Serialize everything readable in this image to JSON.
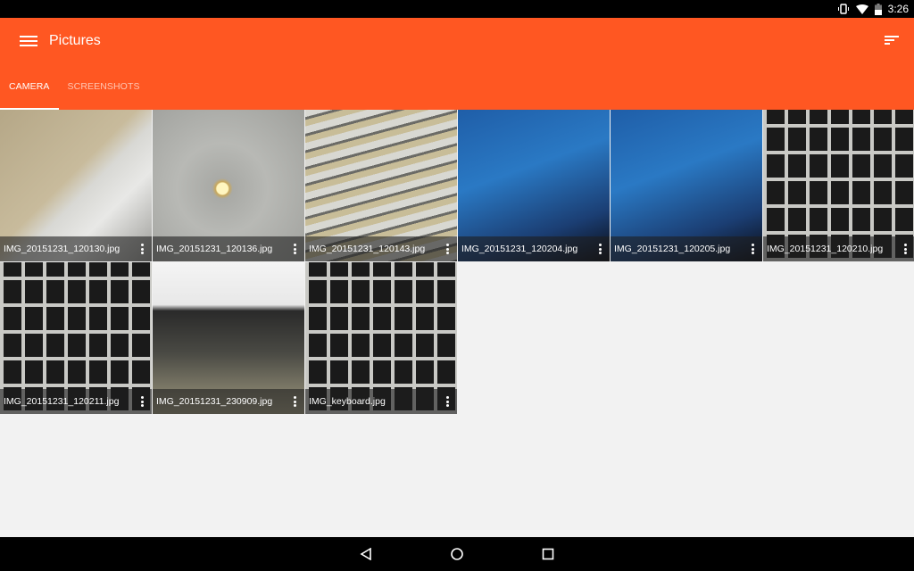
{
  "status_bar": {
    "time": "3:26",
    "icons": [
      "vibrate-icon",
      "wifi-icon",
      "battery-icon"
    ]
  },
  "app_bar": {
    "title": "Pictures",
    "menu_icon": "hamburger-menu-icon",
    "sort_icon": "sort-icon"
  },
  "tabs": [
    {
      "label": "CAMERA",
      "active": true
    },
    {
      "label": "SCREENSHOTS",
      "active": false
    }
  ],
  "photos": [
    {
      "name": "IMG_20151231_120130.jpg",
      "scene": "heater"
    },
    {
      "name": "IMG_20151231_120136.jpg",
      "scene": "ceiling"
    },
    {
      "name": "IMG_20151231_120143.jpg",
      "scene": "blinds"
    },
    {
      "name": "IMG_20151231_120204.jpg",
      "scene": "screen"
    },
    {
      "name": "IMG_20151231_120205.jpg",
      "scene": "screen"
    },
    {
      "name": "IMG_20151231_120210.jpg",
      "scene": "keyboard"
    },
    {
      "name": "IMG_20151231_120211.jpg",
      "scene": "keyboard"
    },
    {
      "name": "IMG_20151231_230909.jpg",
      "scene": "laptop"
    },
    {
      "name": "IMG_keyboard.jpg",
      "scene": "keyboard"
    }
  ],
  "nav_bar": {
    "buttons": [
      "back-icon",
      "home-icon",
      "recents-icon"
    ]
  }
}
